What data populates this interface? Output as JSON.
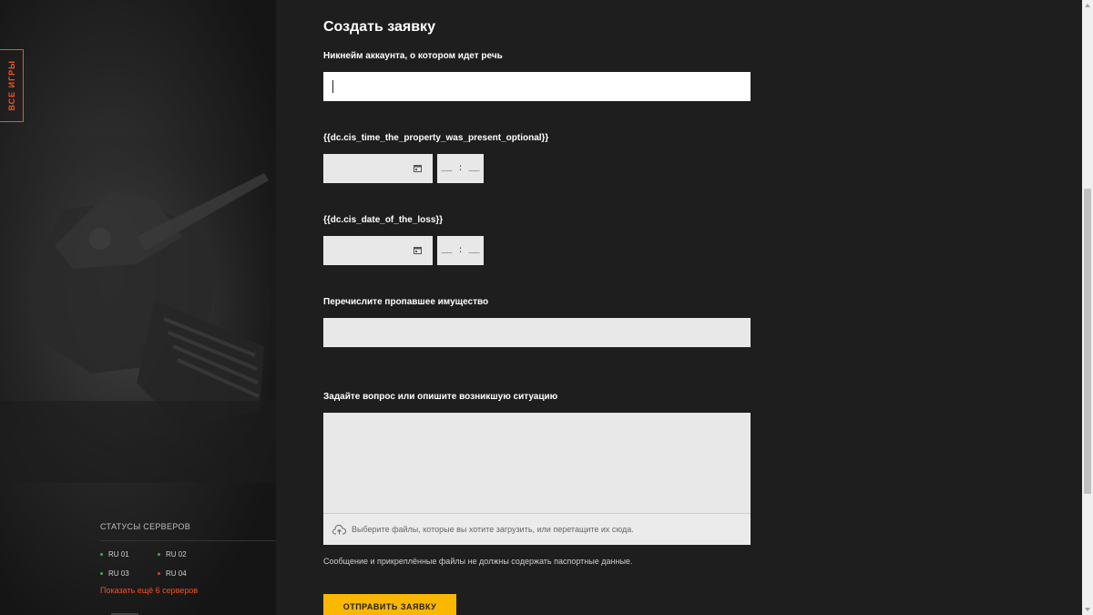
{
  "sidebar": {
    "all_games_label": "ВСЕ ИГРЫ",
    "status_title": "СТАТУСЫ СЕРВЕРОВ",
    "servers": [
      {
        "name": "RU 01",
        "status_color": "#3cb043"
      },
      {
        "name": "RU 02",
        "status_color": "#3cb043"
      },
      {
        "name": "RU 03",
        "status_color": "#3cb043"
      },
      {
        "name": "RU 04",
        "status_color": "#e53935"
      }
    ],
    "more_servers_link": "Показать ещё 6 серверов"
  },
  "form": {
    "title": "Создать заявку",
    "nickname_label": "Никнейм аккаунта, о котором идет речь",
    "nickname_value": "",
    "time_present_label": "{{dc.cis_time_the_property_was_present_optional}}",
    "date_loss_label": "{{dc.cis_date_of_the_loss}}",
    "time_placeholder": "__ : __",
    "property_label": "Перечислите пропавшее имущество",
    "question_label": "Задайте вопрос или опишите возникшую ситуацию",
    "upload_text": "Выберите файлы, которые вы хотите загрузить, или перетащите их сюда.",
    "note_text": "Сообщение и прикреплённые файлы не должны содержать паспортные данные.",
    "submit_label": "ОТПРАВИТЬ ЗАЯВКУ"
  },
  "colors": {
    "accent_orange": "#f25322",
    "button_yellow": "#f9b700",
    "background": "#1e1e1e"
  },
  "icons": [
    "calendar-icon",
    "cloud-upload-icon"
  ]
}
